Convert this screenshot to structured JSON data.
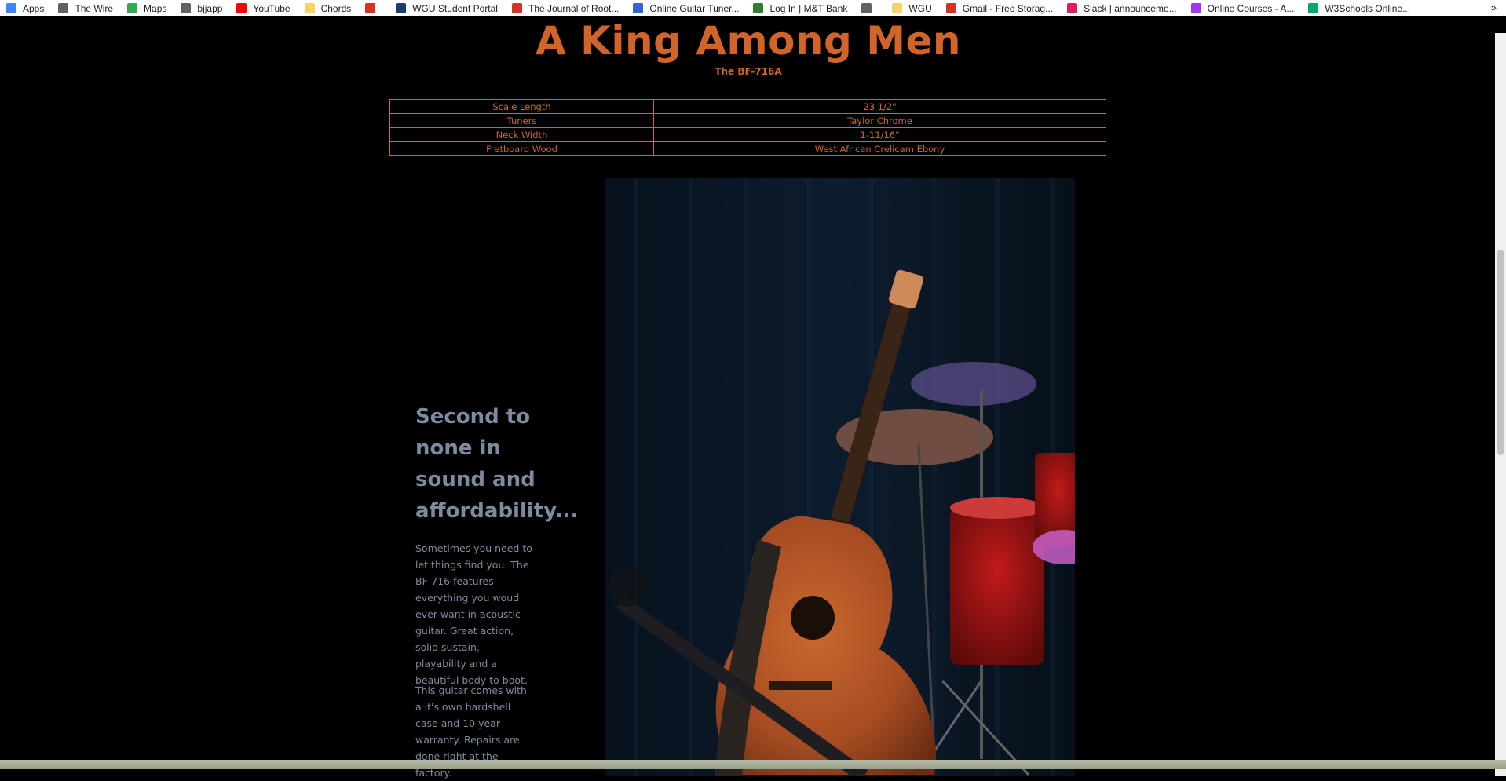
{
  "bookmarks": [
    {
      "label": "Apps",
      "color": "#4285f4"
    },
    {
      "label": "The Wire",
      "color": "#5f6368"
    },
    {
      "label": "Maps",
      "color": "#34a853"
    },
    {
      "label": "bjjapp",
      "color": "#5f6368"
    },
    {
      "label": "YouTube",
      "color": "#ff0000"
    },
    {
      "label": "Chords",
      "color": "#f5d36b"
    },
    {
      "label": "",
      "color": "#d93025"
    },
    {
      "label": "WGU Student Portal",
      "color": "#1a3d6b"
    },
    {
      "label": "The Journal of Root...",
      "color": "#d93025"
    },
    {
      "label": "Online Guitar Tuner...",
      "color": "#3366cc"
    },
    {
      "label": "Log In | M&T Bank",
      "color": "#2e7d32"
    },
    {
      "label": "",
      "color": "#5f6368"
    },
    {
      "label": "WGU",
      "color": "#f5d36b"
    },
    {
      "label": "Gmail - Free Storag...",
      "color": "#d93025"
    },
    {
      "label": "Slack | announceme...",
      "color": "#e01e5a"
    },
    {
      "label": "Online Courses - A...",
      "color": "#a435f0"
    },
    {
      "label": "W3Schools Online...",
      "color": "#04aa6d"
    }
  ],
  "bookmarks_more": "»",
  "header": {
    "title": "A King Among Men",
    "subtitle": "The BF-716A"
  },
  "specs": [
    {
      "key": "Scale Length",
      "value": "23 1/2\""
    },
    {
      "key": "Tuners",
      "value": "Taylor Chrome"
    },
    {
      "key": "Neck Width",
      "value": "1-11/16\""
    },
    {
      "key": "Fretboard Wood",
      "value": "West African Crelicam Ebony"
    }
  ],
  "content": {
    "heading": "Second to none in sound and affordability...",
    "paragraph1": "Sometimes you need to let things find you. The BF-716 features everything you woud ever want in acoustic guitar. Great action, solid sustain, playability and a beautiful body to boot.",
    "paragraph2": "This guitar comes with a it's own hardshell case and 10 year warranty. Repairs are done right at the factory."
  },
  "colors": {
    "accent": "#d2642a",
    "text_muted": "#7d8ba0",
    "background": "#000000"
  }
}
